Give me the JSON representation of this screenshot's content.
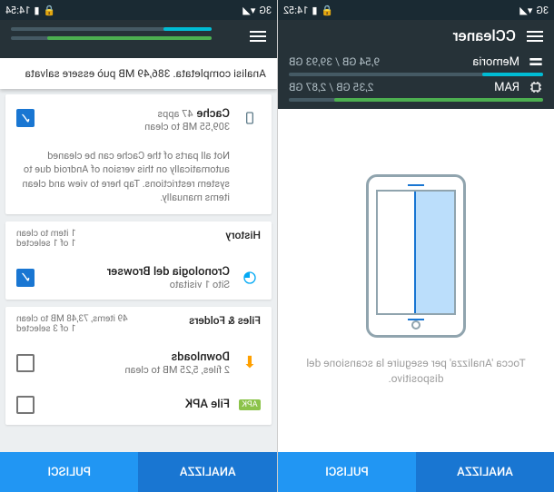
{
  "status": {
    "time_l": "14:52",
    "net_l": "3G",
    "time_r": "14:54",
    "net_r": "3G"
  },
  "app": {
    "title": "CCleaner"
  },
  "metrics": {
    "memory": {
      "label": "Memoria",
      "value": "9,54 GB / 39,93 GB",
      "pct": 24
    },
    "ram": {
      "label": "RAM",
      "value": "2,35 GB / 2,87 GB",
      "pct": 82
    }
  },
  "scan": {
    "hint": "Tocca 'Analizza' per eseguire la scansione del dispositivo."
  },
  "analysis": {
    "banner": "Analisi completata. 386,49 MB può essere salvata"
  },
  "cards": {
    "cache": {
      "title": "Cache",
      "apps": "47 apps",
      "sub": "309,55 MB to clean",
      "note": "Not all parts of the Cache can be cleaned automatically on this version of Android due to system restrictions. Tap here to view and clean items manually."
    },
    "history": {
      "name": "History",
      "meta1": "1 item to clean",
      "meta2": "1 of 1 selected",
      "browser_title": "Cronologia del Browser",
      "browser_sub": "Sito 1 visitato"
    },
    "files": {
      "name": "Files & Folders",
      "meta1": "49 items, 73,48 MB to clean",
      "meta2": "1 of 3 selected",
      "dl_title": "Downloads",
      "dl_sub": "2 files, 5,25 MB to clean",
      "apk_title": "File APK"
    }
  },
  "buttons": {
    "analyze": "ANALIZZA",
    "clean": "PULISCI"
  }
}
